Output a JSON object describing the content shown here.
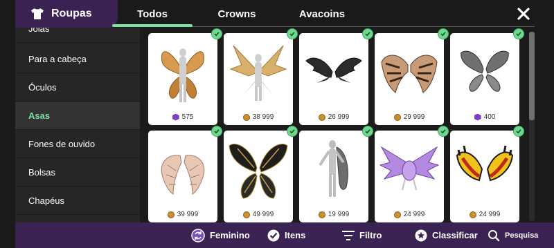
{
  "header": {
    "title": "Roupas",
    "tabs": [
      {
        "label": "Todos",
        "active": true
      },
      {
        "label": "Crowns",
        "active": false
      },
      {
        "label": "Avacoins",
        "active": false
      }
    ]
  },
  "sidebar": {
    "items": [
      {
        "label": "Joias",
        "active": false
      },
      {
        "label": "Para a cabeça",
        "active": false
      },
      {
        "label": "Óculos",
        "active": false
      },
      {
        "label": "Asas",
        "active": true
      },
      {
        "label": "Fones de ouvido",
        "active": false
      },
      {
        "label": "Bolsas",
        "active": false
      },
      {
        "label": "Chapéus",
        "active": false
      }
    ]
  },
  "grid": {
    "items": [
      {
        "price": "575",
        "currency": "gem-icon",
        "owned": true
      },
      {
        "price": "38 999",
        "currency": "coin-icon",
        "owned": true
      },
      {
        "price": "26 999",
        "currency": "coin-icon",
        "owned": true
      },
      {
        "price": "29 999",
        "currency": "coin-icon",
        "owned": true
      },
      {
        "price": "400",
        "currency": "gem-icon",
        "owned": true
      },
      {
        "price": "39 999",
        "currency": "coin-icon",
        "owned": true
      },
      {
        "price": "49 999",
        "currency": "coin-icon",
        "owned": true
      },
      {
        "price": "19 999",
        "currency": "coin-icon",
        "owned": true
      },
      {
        "price": "24 999",
        "currency": "coin-icon",
        "owned": true
      },
      {
        "price": "24 999",
        "currency": "coin-icon",
        "owned": true
      }
    ]
  },
  "bottom_bar": {
    "feminino": "Feminino",
    "itens": "Itens",
    "filtro": "Filtro",
    "classificar": "Classificar",
    "pesquisa": "Pesquisa"
  },
  "colors": {
    "accent_green": "#7ee0a6",
    "header_purple": "#3a2352",
    "check_green": "#6fd88e"
  }
}
